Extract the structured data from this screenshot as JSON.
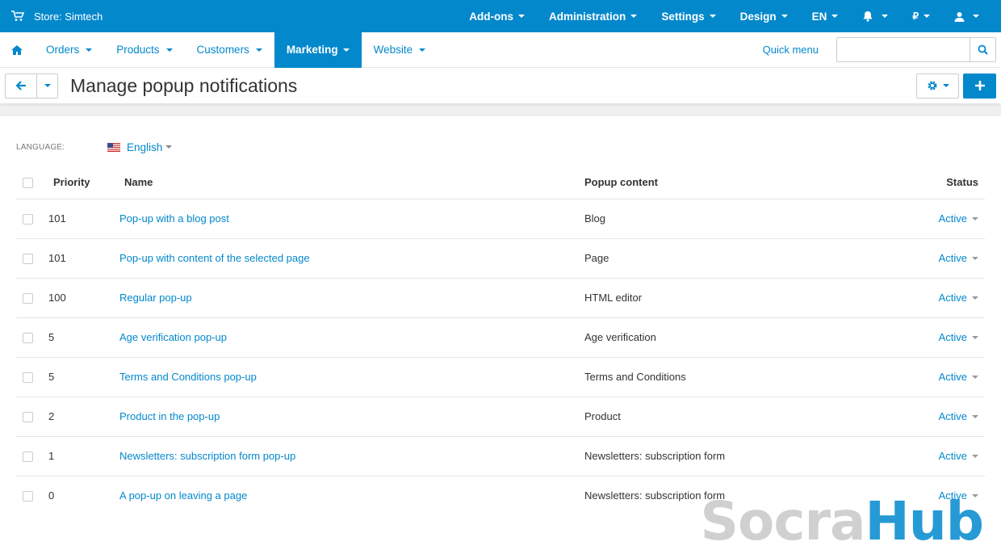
{
  "topbar": {
    "store": "Store: Simtech",
    "items": [
      {
        "label": "Add-ons"
      },
      {
        "label": "Administration"
      },
      {
        "label": "Settings"
      },
      {
        "label": "Design"
      },
      {
        "label": "EN"
      },
      {
        "label": ""
      },
      {
        "label": "₽"
      },
      {
        "label": ""
      }
    ]
  },
  "mainnav": {
    "items": [
      "Orders",
      "Products",
      "Customers",
      "Marketing",
      "Website"
    ],
    "active": "Marketing",
    "quick_menu": "Quick menu",
    "search_placeholder": ""
  },
  "page": {
    "title": "Manage popup notifications"
  },
  "language": {
    "label": "LANGUAGE:",
    "value": "English"
  },
  "table": {
    "headers": {
      "priority": "Priority",
      "name": "Name",
      "content": "Popup content",
      "status": "Status"
    },
    "rows": [
      {
        "priority": "101",
        "name": "Pop-up with a blog post",
        "content": "Blog",
        "status": "Active"
      },
      {
        "priority": "101",
        "name": "Pop-up with content of the selected page",
        "content": "Page",
        "status": "Active"
      },
      {
        "priority": "100",
        "name": "Regular pop-up",
        "content": "HTML editor",
        "status": "Active"
      },
      {
        "priority": "5",
        "name": "Age verification pop-up",
        "content": "Age verification",
        "status": "Active"
      },
      {
        "priority": "5",
        "name": "Terms and Conditions pop-up",
        "content": "Terms and Conditions",
        "status": "Active"
      },
      {
        "priority": "2",
        "name": "Product in the pop-up",
        "content": "Product",
        "status": "Active"
      },
      {
        "priority": "1",
        "name": "Newsletters: subscription form pop-up",
        "content": "Newsletters: subscription form",
        "status": "Active"
      },
      {
        "priority": "0",
        "name": "A pop-up on leaving a page",
        "content": "Newsletters: subscription form",
        "status": "Active"
      }
    ]
  },
  "watermark": {
    "part1": "Socra",
    "part2": "Hub"
  },
  "colors": {
    "accent": "#0388cc"
  }
}
